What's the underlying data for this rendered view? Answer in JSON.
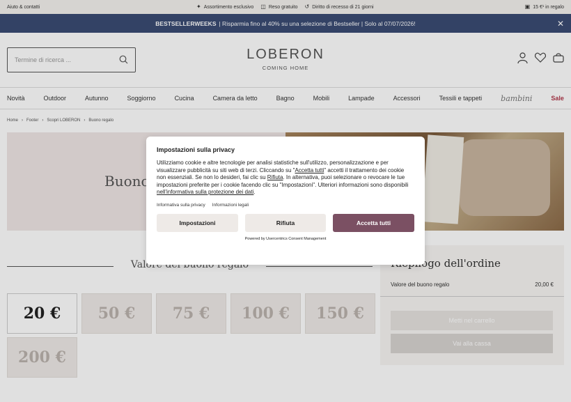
{
  "topbar": {
    "help": "Aiuto & contatti",
    "items": [
      {
        "icon": "leaf-icon",
        "label": "Assortimento esclusivo"
      },
      {
        "icon": "box-icon",
        "label": "Reso gratuito"
      },
      {
        "icon": "return-arrow-icon",
        "label": "Diritto di recesso di 21 giorni"
      }
    ],
    "gift": "15 €¹ in regalo"
  },
  "promo": {
    "bold": "BESTSELLERWEEKS",
    "text": "| Risparmia fino al 40% su una selezione di Bestseller | Solo al 07/07/2026!"
  },
  "header": {
    "search_placeholder": "Termine di ricerca ...",
    "brand": "LOBERON",
    "tagline": "COMING HOME"
  },
  "nav": {
    "items": [
      "Novità",
      "Outdoor",
      "Autunno",
      "Soggiorno",
      "Cucina",
      "Camera da letto",
      "Bagno",
      "Mobili",
      "Lampade",
      "Accessori",
      "Tessili e tappeti"
    ],
    "bambini": "bambini",
    "sale": "Sale"
  },
  "breadcrumb": [
    "Home",
    "Footer",
    "Scopri LOBERON",
    "Buono regalo"
  ],
  "hero": {
    "title": "Buono"
  },
  "values": {
    "title": "Valore del buono regalo",
    "options": [
      "20 €",
      "50 €",
      "75 €",
      "100 €",
      "150 €",
      "200 €"
    ],
    "selected_index": 0
  },
  "summary": {
    "title": "Riepilogo dell'ordine",
    "label": "Valore del buono regalo",
    "value": "20,00 €",
    "btn1": "Metti nel carrello",
    "btn2": "Vai alla cassa"
  },
  "consent": {
    "title": "Impostazioni sulla privacy",
    "body_1": "Utilizziamo cookie e altre tecnologie per analisi statistiche sull'utilizzo, personalizzazione e per visualizzare pubblicità su siti web di terzi. Cliccando su \"",
    "accept_link": "Accetta tutti",
    "body_2": "\" accetti il trattamento dei cookie non essenziali. Se non lo desideri, fai clic su ",
    "reject_link": "Rifiuta",
    "body_3": ". In alternativa, puoi selezionare o revocare le tue impostazioni preferite per i cookie facendo clic su \"Impostazioni\". Ulteriori informazioni sono disponibili ",
    "info_link": "nell'informativa sulla protezione dei dati",
    "body_4": ".",
    "link_privacy": "Informativa sulla privacy",
    "link_legal": "Informazioni legali",
    "btn_settings": "Impostazioni",
    "btn_reject": "Rifiuta",
    "btn_accept": "Accetta tutti",
    "powered": "Powered by Usercentrics Consent Management",
    "accent_color": "#7b5063"
  }
}
